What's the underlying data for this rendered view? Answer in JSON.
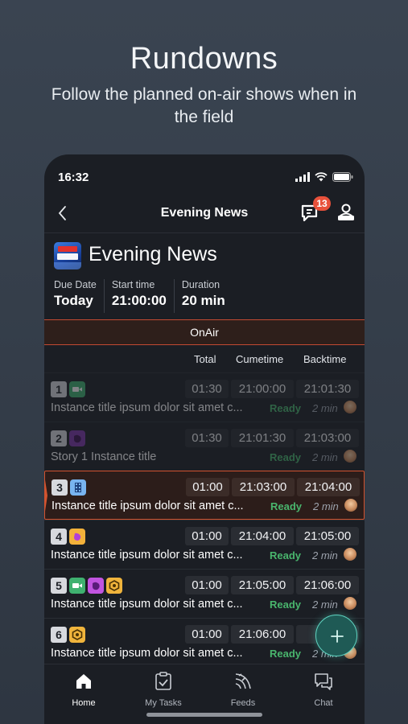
{
  "promo": {
    "title": "Rundowns",
    "subtitle": "Follow the planned on-air shows when in the field"
  },
  "status_bar": {
    "time": "16:32",
    "icons": [
      "signal-icon",
      "wifi-icon",
      "battery-icon"
    ]
  },
  "navbar": {
    "title": "Evening News",
    "chat_badge": "13"
  },
  "rundown": {
    "logo_name": "news-hour-logo",
    "title": "Evening News",
    "meta": [
      {
        "label": "Due Date",
        "value": "Today"
      },
      {
        "label": "Start time",
        "value": "21:00:00"
      },
      {
        "label": "Duration",
        "value": "20 min"
      }
    ],
    "onair_label": "OnAir",
    "columns": [
      "Total",
      "Cumetime",
      "Backtime"
    ]
  },
  "rows": [
    {
      "num": "1",
      "total": "01:30",
      "cume": "21:00:00",
      "back": "21:01:30",
      "title": "Instance title ipsum dolor sit amet c...",
      "status": "Ready",
      "duration": "2 min",
      "state": "dim",
      "tags": [
        "video"
      ]
    },
    {
      "num": "2",
      "total": "01:30",
      "cume": "21:01:30",
      "back": "21:03:00",
      "title": "Story 1 Instance title",
      "status": "Ready",
      "duration": "2 min",
      "state": "dim",
      "tags": [
        "dark"
      ]
    },
    {
      "num": "3",
      "total": "01:00",
      "cume": "21:03:00",
      "back": "21:04:00",
      "title": "Instance title ipsum dolor sit amet c...",
      "status": "Ready",
      "duration": "2 min",
      "state": "active",
      "tags": [
        "blue"
      ]
    },
    {
      "num": "4",
      "total": "01:00",
      "cume": "21:04:00",
      "back": "21:05:00",
      "title": "Instance title ipsum dolor sit amet c...",
      "status": "Ready",
      "duration": "2 min",
      "state": "normal",
      "tags": [
        "orange-purple"
      ]
    },
    {
      "num": "5",
      "total": "01:00",
      "cume": "21:05:00",
      "back": "21:06:00",
      "title": "Instance title ipsum dolor sit amet c...",
      "status": "Ready",
      "duration": "2 min",
      "state": "normal",
      "tags": [
        "video",
        "purple",
        "yellow"
      ]
    },
    {
      "num": "6",
      "total": "01:00",
      "cume": "21:06:00",
      "back": "21:",
      "title": "Instance title ipsum dolor sit amet c...",
      "status": "Ready",
      "duration": "2 min",
      "state": "normal",
      "tags": [
        "yellow"
      ]
    }
  ],
  "tabs": [
    {
      "label": "Home",
      "icon": "home-icon",
      "active": true
    },
    {
      "label": "My Tasks",
      "icon": "clipboard-check-icon",
      "active": false
    },
    {
      "label": "Feeds",
      "icon": "feeds-icon",
      "active": false
    },
    {
      "label": "Chat",
      "icon": "chat-icon",
      "active": false
    }
  ],
  "colors": {
    "accent": "#d2532f",
    "ready": "#49b56d",
    "badge": "#e8513b",
    "fab": "#5fd3c0"
  }
}
